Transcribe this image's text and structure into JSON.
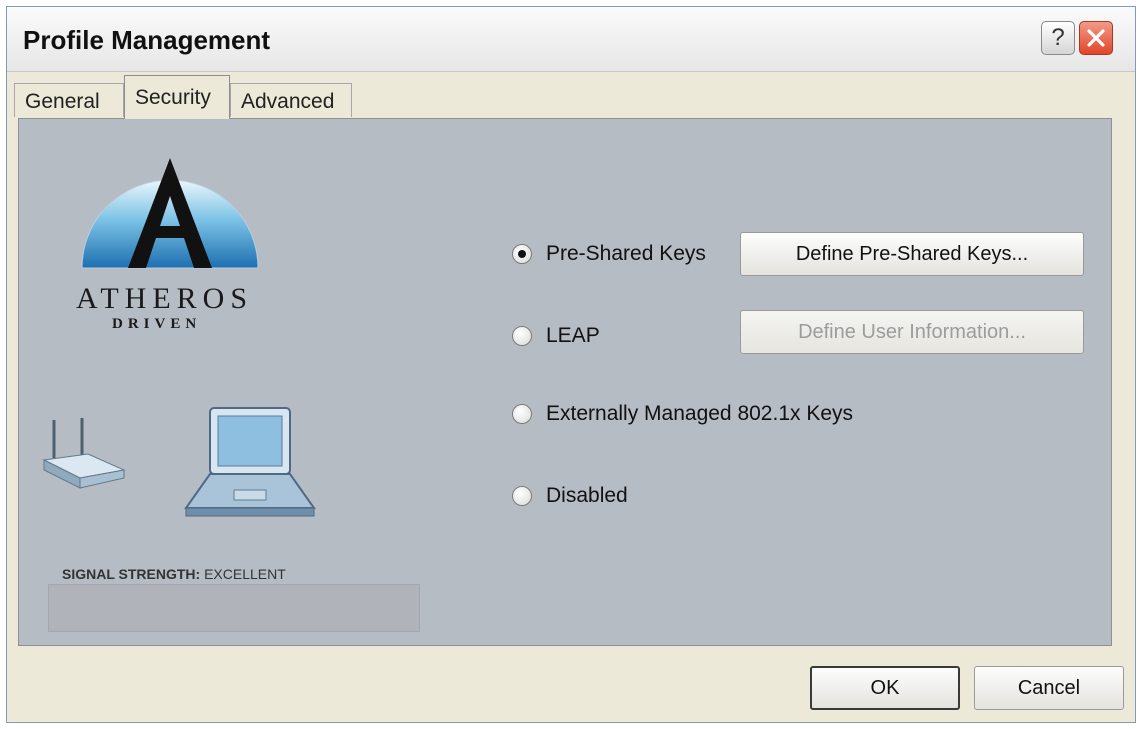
{
  "window": {
    "title": "Profile Management"
  },
  "titlebar": {
    "help_label": "?",
    "close_icon": "close-x-icon",
    "help_icon": "help-question-icon"
  },
  "tabs": [
    {
      "label": "General",
      "active": false
    },
    {
      "label": "Security",
      "active": true
    },
    {
      "label": "Advanced",
      "active": false
    }
  ],
  "branding": {
    "brand_line1": "ATHEROS",
    "brand_line2": "DRIVEN"
  },
  "illustration": {
    "router_icon": "wireless-router-icon",
    "laptop_icon": "laptop-icon"
  },
  "signal": {
    "label": "SIGNAL STRENGTH:",
    "value": "EXCELLENT"
  },
  "security_options": [
    {
      "label": "Pre-Shared Keys",
      "selected": true
    },
    {
      "label": "LEAP",
      "selected": false
    },
    {
      "label": "Externally Managed 802.1x Keys",
      "selected": false
    },
    {
      "label": "Disabled",
      "selected": false
    }
  ],
  "buttons": {
    "define_psk": "Define Pre-Shared Keys...",
    "define_user": "Define User Information...",
    "ok": "OK",
    "cancel": "Cancel"
  },
  "colors": {
    "panel": "#b6bcc4",
    "close": "#e0452a",
    "window": "#ece9d8"
  }
}
